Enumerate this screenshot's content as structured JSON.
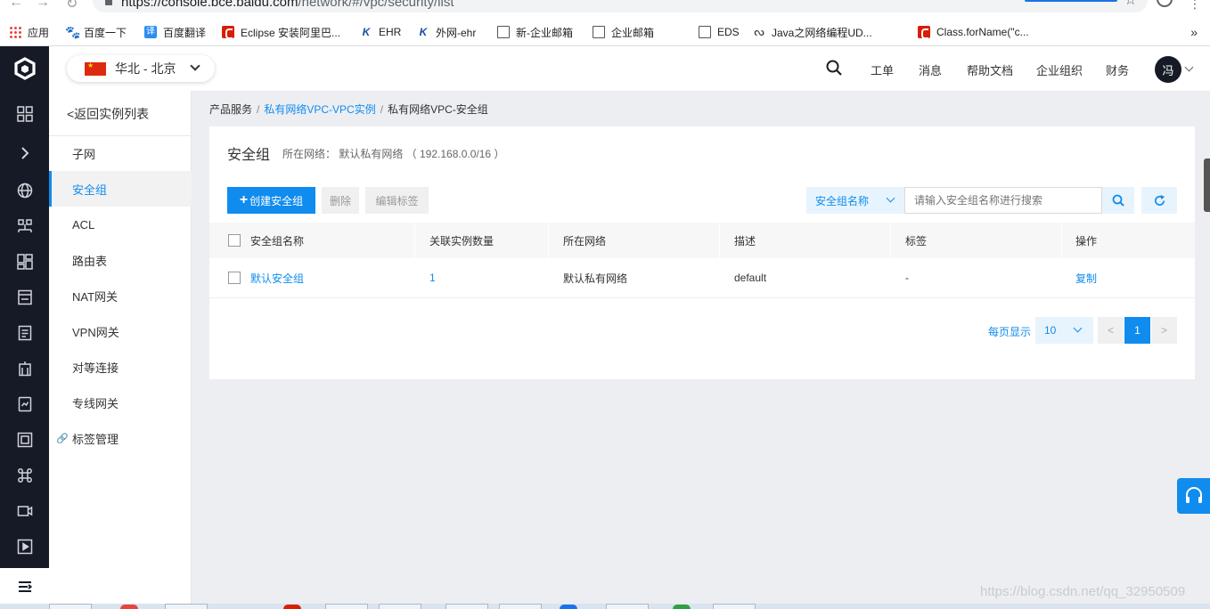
{
  "browser": {
    "url_host": "https://console.bce.baidu.com",
    "url_path": "/network/#/vpc/security/list",
    "bookmarks": [
      {
        "label": "应用",
        "icon": "apps-grid-icon"
      },
      {
        "label": "百度一下",
        "icon": "baidu-paw-icon"
      },
      {
        "label": "百度翻译",
        "icon": "translate-icon"
      },
      {
        "label": "Eclipse 安装阿里巴...",
        "icon": "csdn-icon"
      },
      {
        "label": "EHR",
        "icon": "k-logo-icon"
      },
      {
        "label": "外网-ehr",
        "icon": "k-logo-icon"
      },
      {
        "label": "新-企业邮箱",
        "icon": "page-icon"
      },
      {
        "label": "企业邮箱",
        "icon": "page-icon"
      },
      {
        "label": "EDS",
        "icon": "page-icon"
      },
      {
        "label": "Java之网络编程UD...",
        "icon": "j-logo-icon"
      },
      {
        "label": "Class.forName(\"c...",
        "icon": "csdn-icon"
      }
    ],
    "more": "»"
  },
  "header": {
    "region": "华北 - 北京",
    "links": [
      "工单",
      "消息",
      "帮助文档",
      "企业组织",
      "财务"
    ],
    "avatar": "冯"
  },
  "sidebar": {
    "back": "<返回实例列表",
    "items": [
      {
        "label": "子网",
        "active": false
      },
      {
        "label": "安全组",
        "active": true
      },
      {
        "label": "ACL",
        "active": false
      },
      {
        "label": "路由表",
        "active": false
      },
      {
        "label": "NAT网关",
        "active": false
      },
      {
        "label": "VPN网关",
        "active": false
      },
      {
        "label": "对等连接",
        "active": false
      },
      {
        "label": "专线网关",
        "active": false
      },
      {
        "label": "标签管理",
        "active": false
      }
    ]
  },
  "breadcrumb": {
    "root": "产品服务",
    "parent": "私有网络VPC-VPC实例",
    "current": "私有网络VPC-安全组",
    "sep": "/"
  },
  "page": {
    "title": "安全组",
    "subtitle": "所在网络： 默认私有网络 （ 192.168.0.0/16 ）"
  },
  "toolbar": {
    "create": "创建安全组",
    "delete": "删除",
    "edit_tags": "编辑标签",
    "search_field": "安全组名称",
    "search_placeholder": "请输入安全组名称进行搜索"
  },
  "table": {
    "columns": [
      "安全组名称",
      "关联实例数量",
      "所在网络",
      "描述",
      "标签",
      "操作"
    ],
    "rows": [
      {
        "name": "默认安全组",
        "instances": "1",
        "network": "默认私有网络",
        "desc": "default",
        "tags": "-",
        "action": "复制"
      }
    ]
  },
  "pagination": {
    "label": "每页显示",
    "page_size": "10",
    "prev": "<",
    "next": ">",
    "current_page": "1"
  },
  "watermark": "https://blog.csdn.net/qq_32950509",
  "colors": {
    "accent": "#108cee",
    "rail": "#151a26",
    "background": "#eceef2"
  }
}
